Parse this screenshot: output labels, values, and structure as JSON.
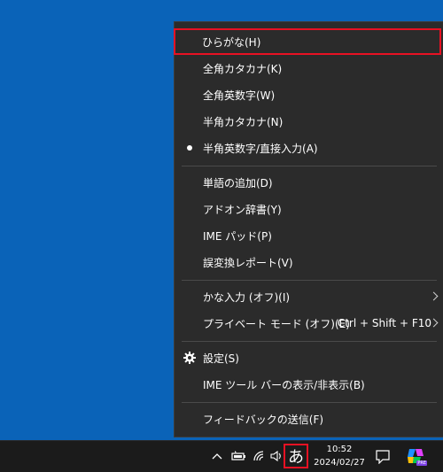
{
  "menu": {
    "groups": [
      {
        "items": [
          {
            "label": "ひらがな(H)",
            "highlighted": true
          },
          {
            "label": "全角カタカナ(K)"
          },
          {
            "label": "全角英数字(W)"
          },
          {
            "label": "半角カタカナ(N)"
          },
          {
            "label": "半角英数字/直接入力(A)",
            "selected": true
          }
        ]
      },
      {
        "items": [
          {
            "label": "単語の追加(D)"
          },
          {
            "label": "アドオン辞書(Y)"
          },
          {
            "label": "IME パッド(P)"
          },
          {
            "label": "誤変換レポート(V)"
          }
        ]
      },
      {
        "items": [
          {
            "label": "かな入力 (オフ)(I)",
            "submenu": true
          },
          {
            "label": "プライベート モード (オフ)(E)",
            "shortcut": "Ctrl + Shift + F10",
            "submenu": true
          }
        ]
      },
      {
        "items": [
          {
            "label": "設定(S)",
            "icon": "gear-icon"
          },
          {
            "label": "IME ツール バーの表示/非表示(B)"
          }
        ]
      },
      {
        "items": [
          {
            "label": "フィードバックの送信(F)"
          }
        ]
      }
    ]
  },
  "taskbar": {
    "ime_mode": "あ",
    "time": "10:52",
    "date": "2024/02/27",
    "tray_icons": [
      "chevron-up-icon",
      "battery-icon",
      "wifi-icon",
      "volume-icon"
    ],
    "notification_icon": "notification-icon",
    "copilot_icon": "copilot-icon",
    "copilot_badge": "PRE"
  },
  "colors": {
    "desktop": "#0a63b8",
    "menu_bg": "#2b2b2b",
    "highlight_border": "#e81123",
    "taskbar_bg": "#1b1b1b"
  }
}
